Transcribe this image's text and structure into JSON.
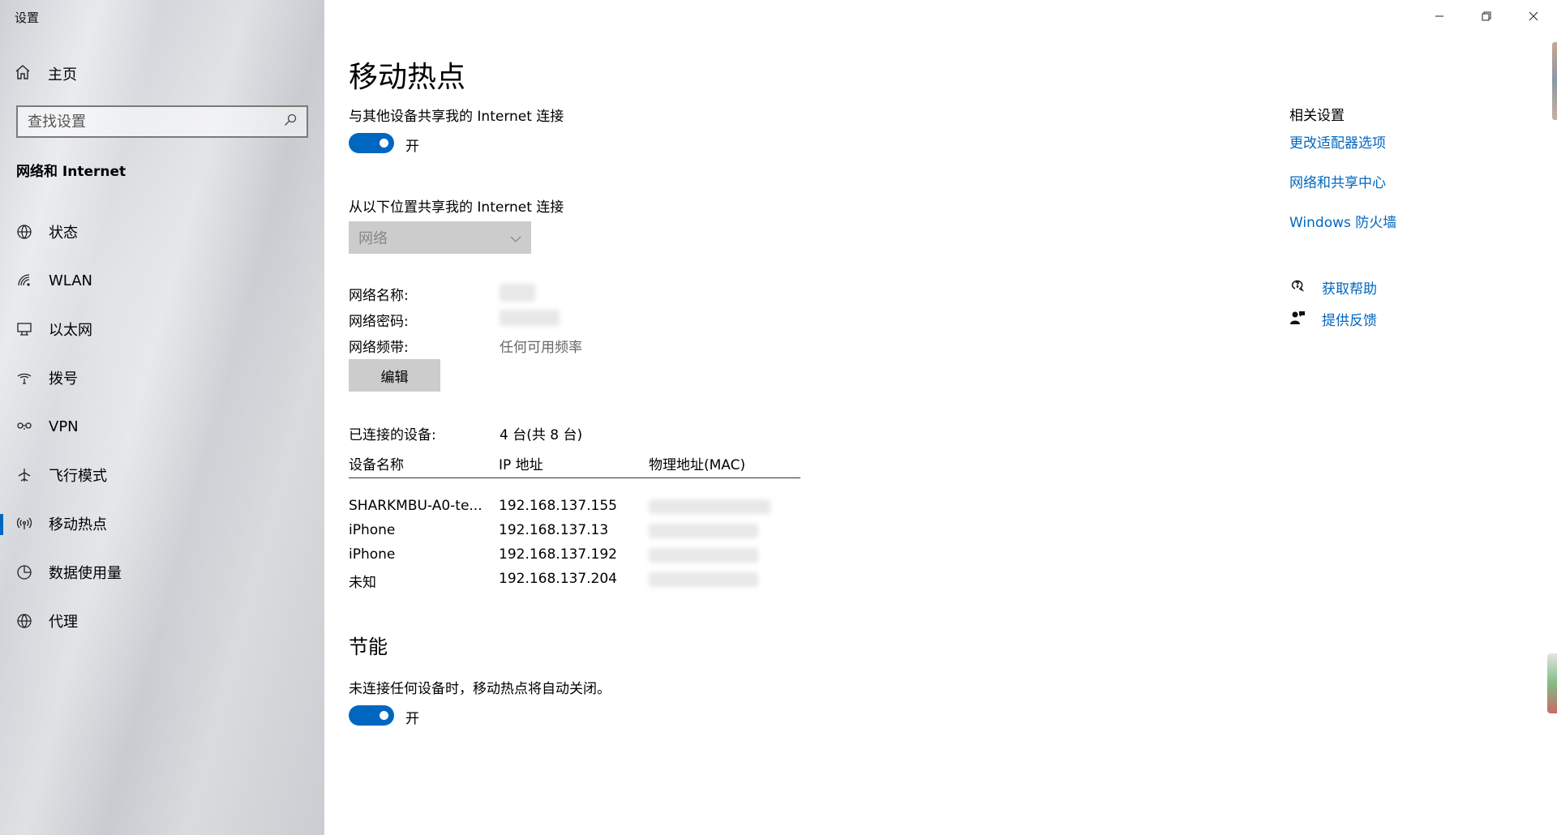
{
  "app": {
    "title": "设置"
  },
  "sidebar": {
    "home_label": "主页",
    "search": {
      "placeholder": "查找设置",
      "value": ""
    },
    "section_title": "网络和 Internet",
    "items": [
      {
        "label": "状态",
        "icon": "globe-status-icon"
      },
      {
        "label": "WLAN",
        "icon": "wifi-icon"
      },
      {
        "label": "以太网",
        "icon": "ethernet-icon"
      },
      {
        "label": "拨号",
        "icon": "dialup-icon"
      },
      {
        "label": "VPN",
        "icon": "vpn-icon"
      },
      {
        "label": "飞行模式",
        "icon": "airplane-icon"
      },
      {
        "label": "移动热点",
        "icon": "hotspot-icon",
        "active": true
      },
      {
        "label": "数据使用量",
        "icon": "data-usage-icon"
      },
      {
        "label": "代理",
        "icon": "globe-proxy-icon"
      }
    ]
  },
  "main": {
    "title": "移动热点",
    "share_label": "与其他设备共享我的 Internet 连接",
    "share_toggle": {
      "state_label": "开",
      "on": true
    },
    "share_from_label": "从以下位置共享我的 Internet 连接",
    "share_from_value": "网络",
    "network_name_label": "网络名称:",
    "network_password_label": "网络密码:",
    "network_band_label": "网络频带:",
    "network_band_value": "任何可用频率",
    "edit_button": "编辑",
    "connected_label": "已连接的设备:",
    "connected_value": "4 台(共 8 台)",
    "table": {
      "headers": [
        "设备名称",
        "IP 地址",
        "物理地址(MAC)"
      ],
      "rows": [
        {
          "name": "SHARKMBU-A0-te...",
          "ip": "192.168.137.155"
        },
        {
          "name": "iPhone",
          "ip": "192.168.137.13"
        },
        {
          "name": "iPhone",
          "ip": "192.168.137.192"
        },
        {
          "name": "未知",
          "ip": "192.168.137.204"
        }
      ]
    },
    "power_title": "节能",
    "power_desc": "未连接任何设备时，移动热点将自动关闭。",
    "power_toggle": {
      "state_label": "开",
      "on": true
    }
  },
  "related": {
    "title": "相关设置",
    "links": [
      "更改适配器选项",
      "网络和共享中心",
      "Windows 防火墙"
    ],
    "help": {
      "label": "获取帮助",
      "icon": "help-chat-icon"
    },
    "feedback": {
      "label": "提供反馈",
      "icon": "feedback-icon"
    }
  },
  "colors": {
    "accent": "#0067c0",
    "link": "#0067c0"
  }
}
